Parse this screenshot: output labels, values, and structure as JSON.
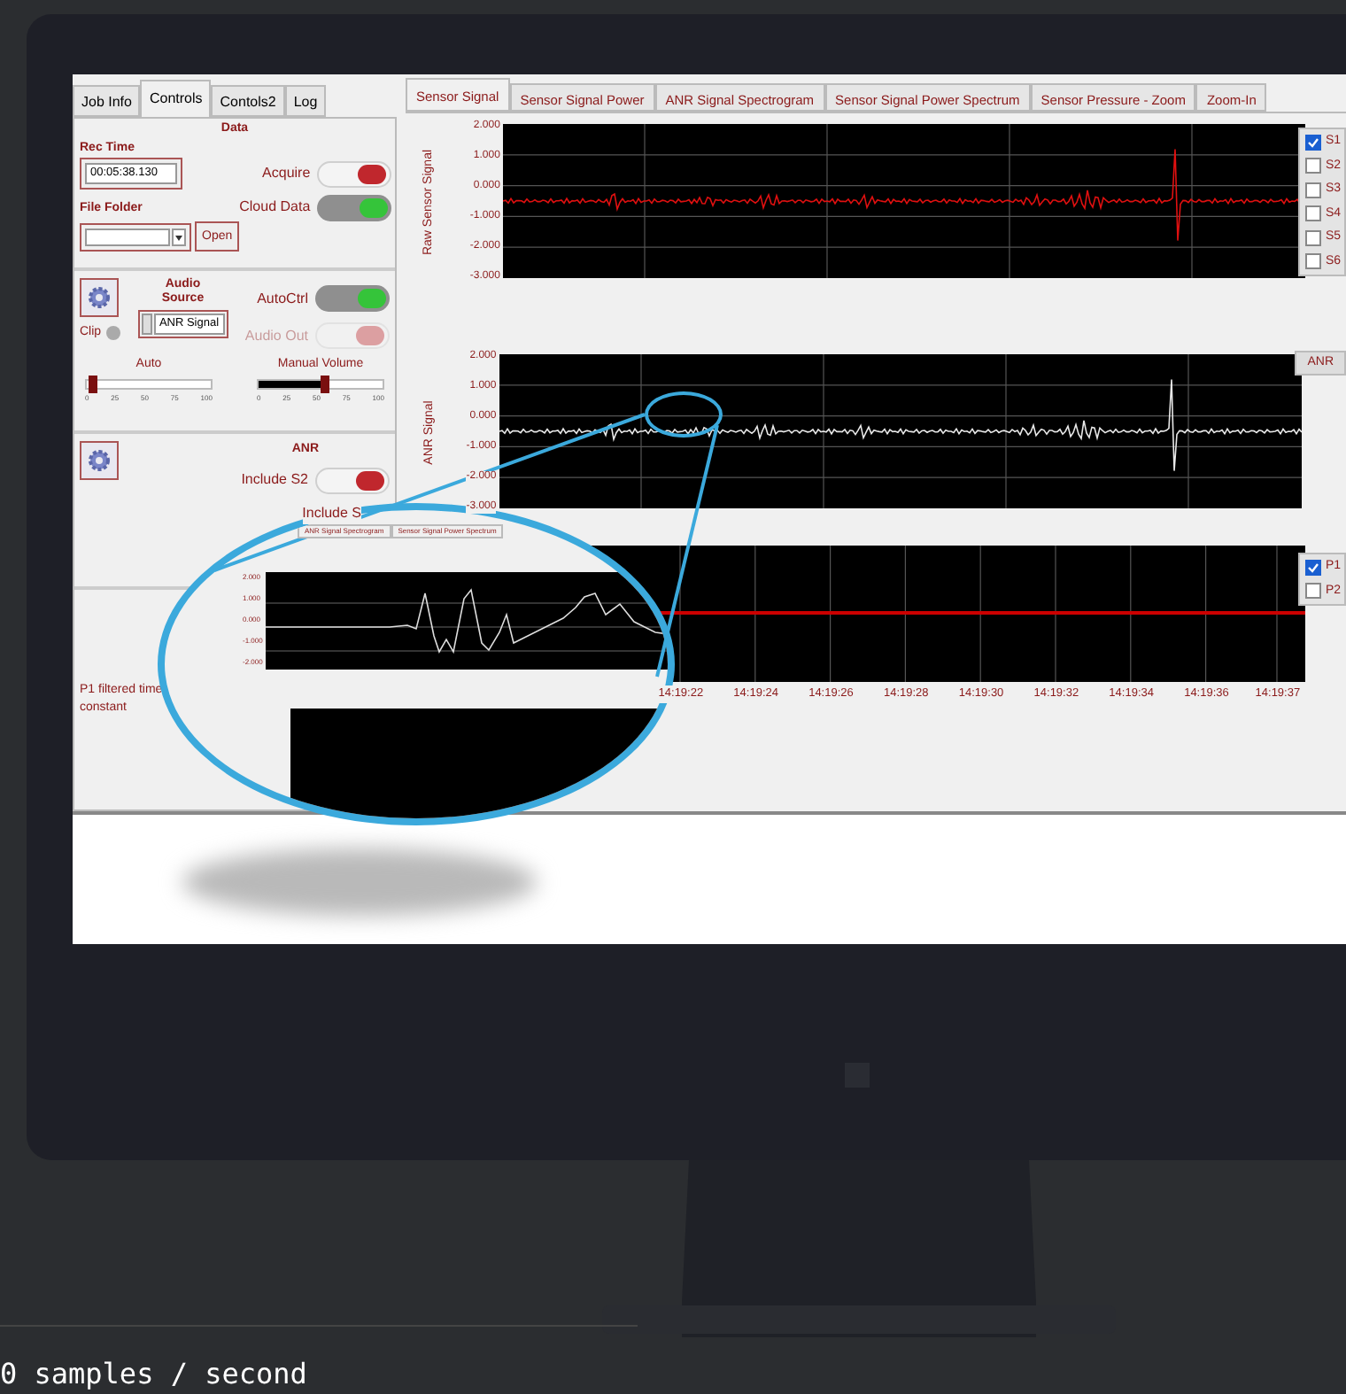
{
  "left_panel": {
    "tabs": [
      {
        "label": "Job Info",
        "selected": false
      },
      {
        "label": "Controls",
        "selected": true
      },
      {
        "label": "Contols2",
        "selected": false
      },
      {
        "label": "Log",
        "selected": false
      }
    ],
    "data_section": {
      "title": "Data",
      "rec_time_label": "Rec Time",
      "rec_time_value": "00:05:38.130",
      "file_folder_label": "File Folder",
      "open_button": "Open",
      "toggles": [
        {
          "label": "Acquire",
          "on": false,
          "disabled": false
        },
        {
          "label": "Cloud Data",
          "on": true,
          "disabled": false
        }
      ]
    },
    "audio_section": {
      "title": "Audio Source",
      "clip_label": "Clip",
      "source_value": "ANR Signal",
      "toggles": [
        {
          "label": "AutoCtrl",
          "on": true,
          "disabled": false
        },
        {
          "label": "Audio Out",
          "on": false,
          "disabled": true
        }
      ],
      "sliders": [
        {
          "label": "Auto",
          "level": 0.02,
          "scale": [
            "0",
            "25",
            "50",
            "75",
            "100"
          ]
        },
        {
          "label": "Manual Volume",
          "level": 0.5,
          "scale": [
            "0",
            "25",
            "50",
            "75",
            "100"
          ]
        }
      ]
    },
    "anr_section": {
      "title": "ANR",
      "toggles": [
        {
          "label": "Include S2",
          "on": false,
          "disabled": false
        }
      ],
      "partial_label": "Include S"
    },
    "time_constant_label": "P1 filtered time constant"
  },
  "right_panel": {
    "tabs": [
      {
        "label": "Sensor Signal",
        "selected": true
      },
      {
        "label": "Sensor Signal Power",
        "selected": false
      },
      {
        "label": "ANR Signal Spectrogram",
        "selected": false
      },
      {
        "label": "Sensor Signal Power Spectrum",
        "selected": false
      },
      {
        "label": "Sensor Pressure - Zoom",
        "selected": false
      },
      {
        "label": "Zoom-In",
        "selected": false
      }
    ],
    "raw_chart": {
      "ylabel": "Raw Sensor Signal",
      "yticks": [
        "2.000",
        "1.000",
        "0.000",
        "-1.000",
        "-2.000",
        "-3.000"
      ],
      "legend": [
        {
          "label": "S1",
          "checked": true
        },
        {
          "label": "S2",
          "checked": false
        },
        {
          "label": "S3",
          "checked": false
        },
        {
          "label": "S4",
          "checked": false
        },
        {
          "label": "S5",
          "checked": false
        },
        {
          "label": "S6",
          "checked": false
        }
      ]
    },
    "anr_chart": {
      "ylabel": "ANR Signal",
      "yticks": [
        "2.000",
        "1.000",
        "0.000",
        "-1.000",
        "-2.000",
        "-3.000"
      ],
      "button": "ANR"
    },
    "pressure_chart": {
      "xticks": [
        "14:19:22",
        "14:19:24",
        "14:19:26",
        "14:19:28",
        "14:19:30",
        "14:19:32",
        "14:19:34",
        "14:19:36",
        "14:19:37"
      ],
      "legend": [
        {
          "label": "P1",
          "checked": true
        },
        {
          "label": "P2",
          "checked": false
        }
      ]
    }
  },
  "magnifier": {
    "tabs": [
      "ANR Signal Spectrogram",
      "Sensor Signal Power Spectrum"
    ],
    "yticks": [
      "2.000",
      "1.000",
      "0.000",
      "-1.000",
      "-2.000"
    ]
  },
  "footer_text": "0 samples / second"
}
